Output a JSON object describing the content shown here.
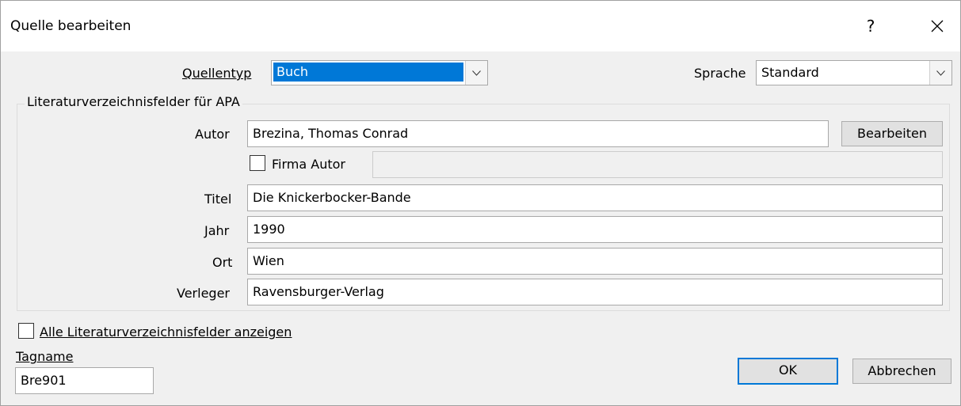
{
  "dialog": {
    "title": "Quelle bearbeiten",
    "help_label": "?"
  },
  "source_type": {
    "label": "Quellentyp",
    "value": "Buch"
  },
  "language": {
    "label": "Sprache",
    "value": "Standard"
  },
  "group": {
    "title": "Literaturverzeichnisfelder für APA",
    "author": {
      "label": "Autor",
      "value": "Brezina, Thomas Conrad",
      "edit_button": "Bearbeiten"
    },
    "corporate_author": {
      "label": "Firma Autor",
      "checked": false,
      "value": ""
    },
    "title_field": {
      "label": "Titel",
      "value": "Die Knickerbocker-Bande"
    },
    "year": {
      "label": "Jahr",
      "value": "1990"
    },
    "city": {
      "label": "Ort",
      "value": "Wien"
    },
    "publisher": {
      "label": "Verleger",
      "value": "Ravensburger-Verlag"
    }
  },
  "show_all": {
    "label": "Alle Literaturverzeichnisfelder anzeigen",
    "checked": false
  },
  "tag": {
    "label": "Tagname",
    "value": "Bre901"
  },
  "buttons": {
    "ok": "OK",
    "cancel": "Abbrechen"
  },
  "colors": {
    "accent": "#0078d7",
    "dialog_bg": "#f0f0f0",
    "titlebar_bg": "#ffffff"
  }
}
